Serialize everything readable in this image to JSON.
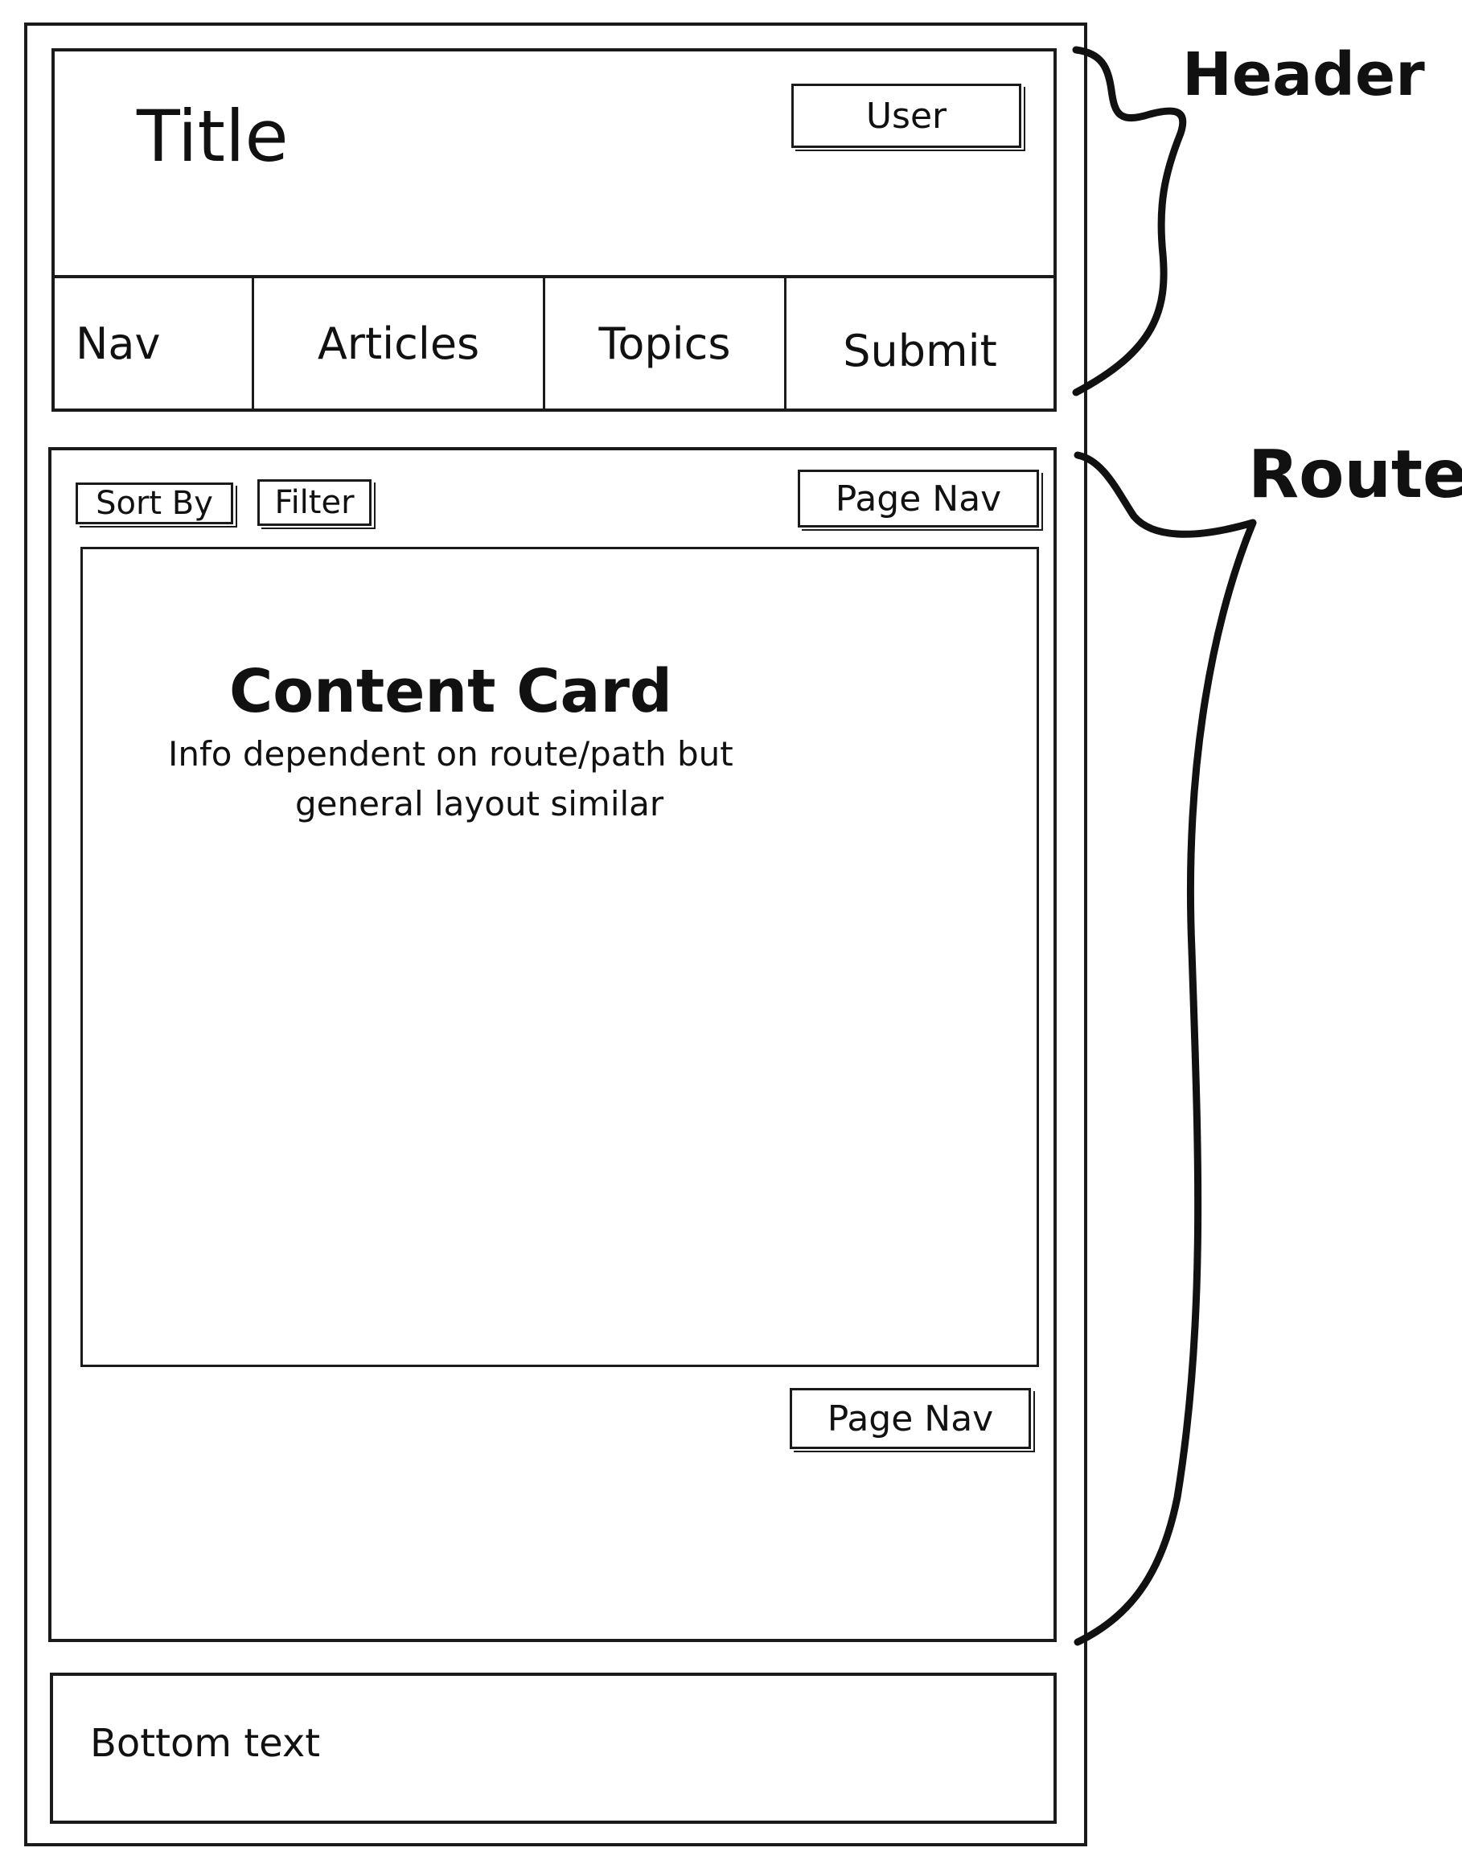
{
  "header": {
    "title": "Title",
    "user_button": "User",
    "nav_items": [
      {
        "label": "Nav"
      },
      {
        "label": "Articles"
      },
      {
        "label": "Topics"
      },
      {
        "label": "Submit"
      }
    ]
  },
  "route": {
    "sort_button": "Sort By",
    "filter_button": "Filter",
    "page_nav_top": "Page Nav",
    "content_card": {
      "heading": "Content Card",
      "line1": "Info dependent on route/path but",
      "line2": "general layout similar"
    },
    "page_nav_bottom": "Page Nav"
  },
  "footer": {
    "text": "Bottom text"
  },
  "annotations": {
    "header_label": "Header",
    "route_label": "Route"
  }
}
